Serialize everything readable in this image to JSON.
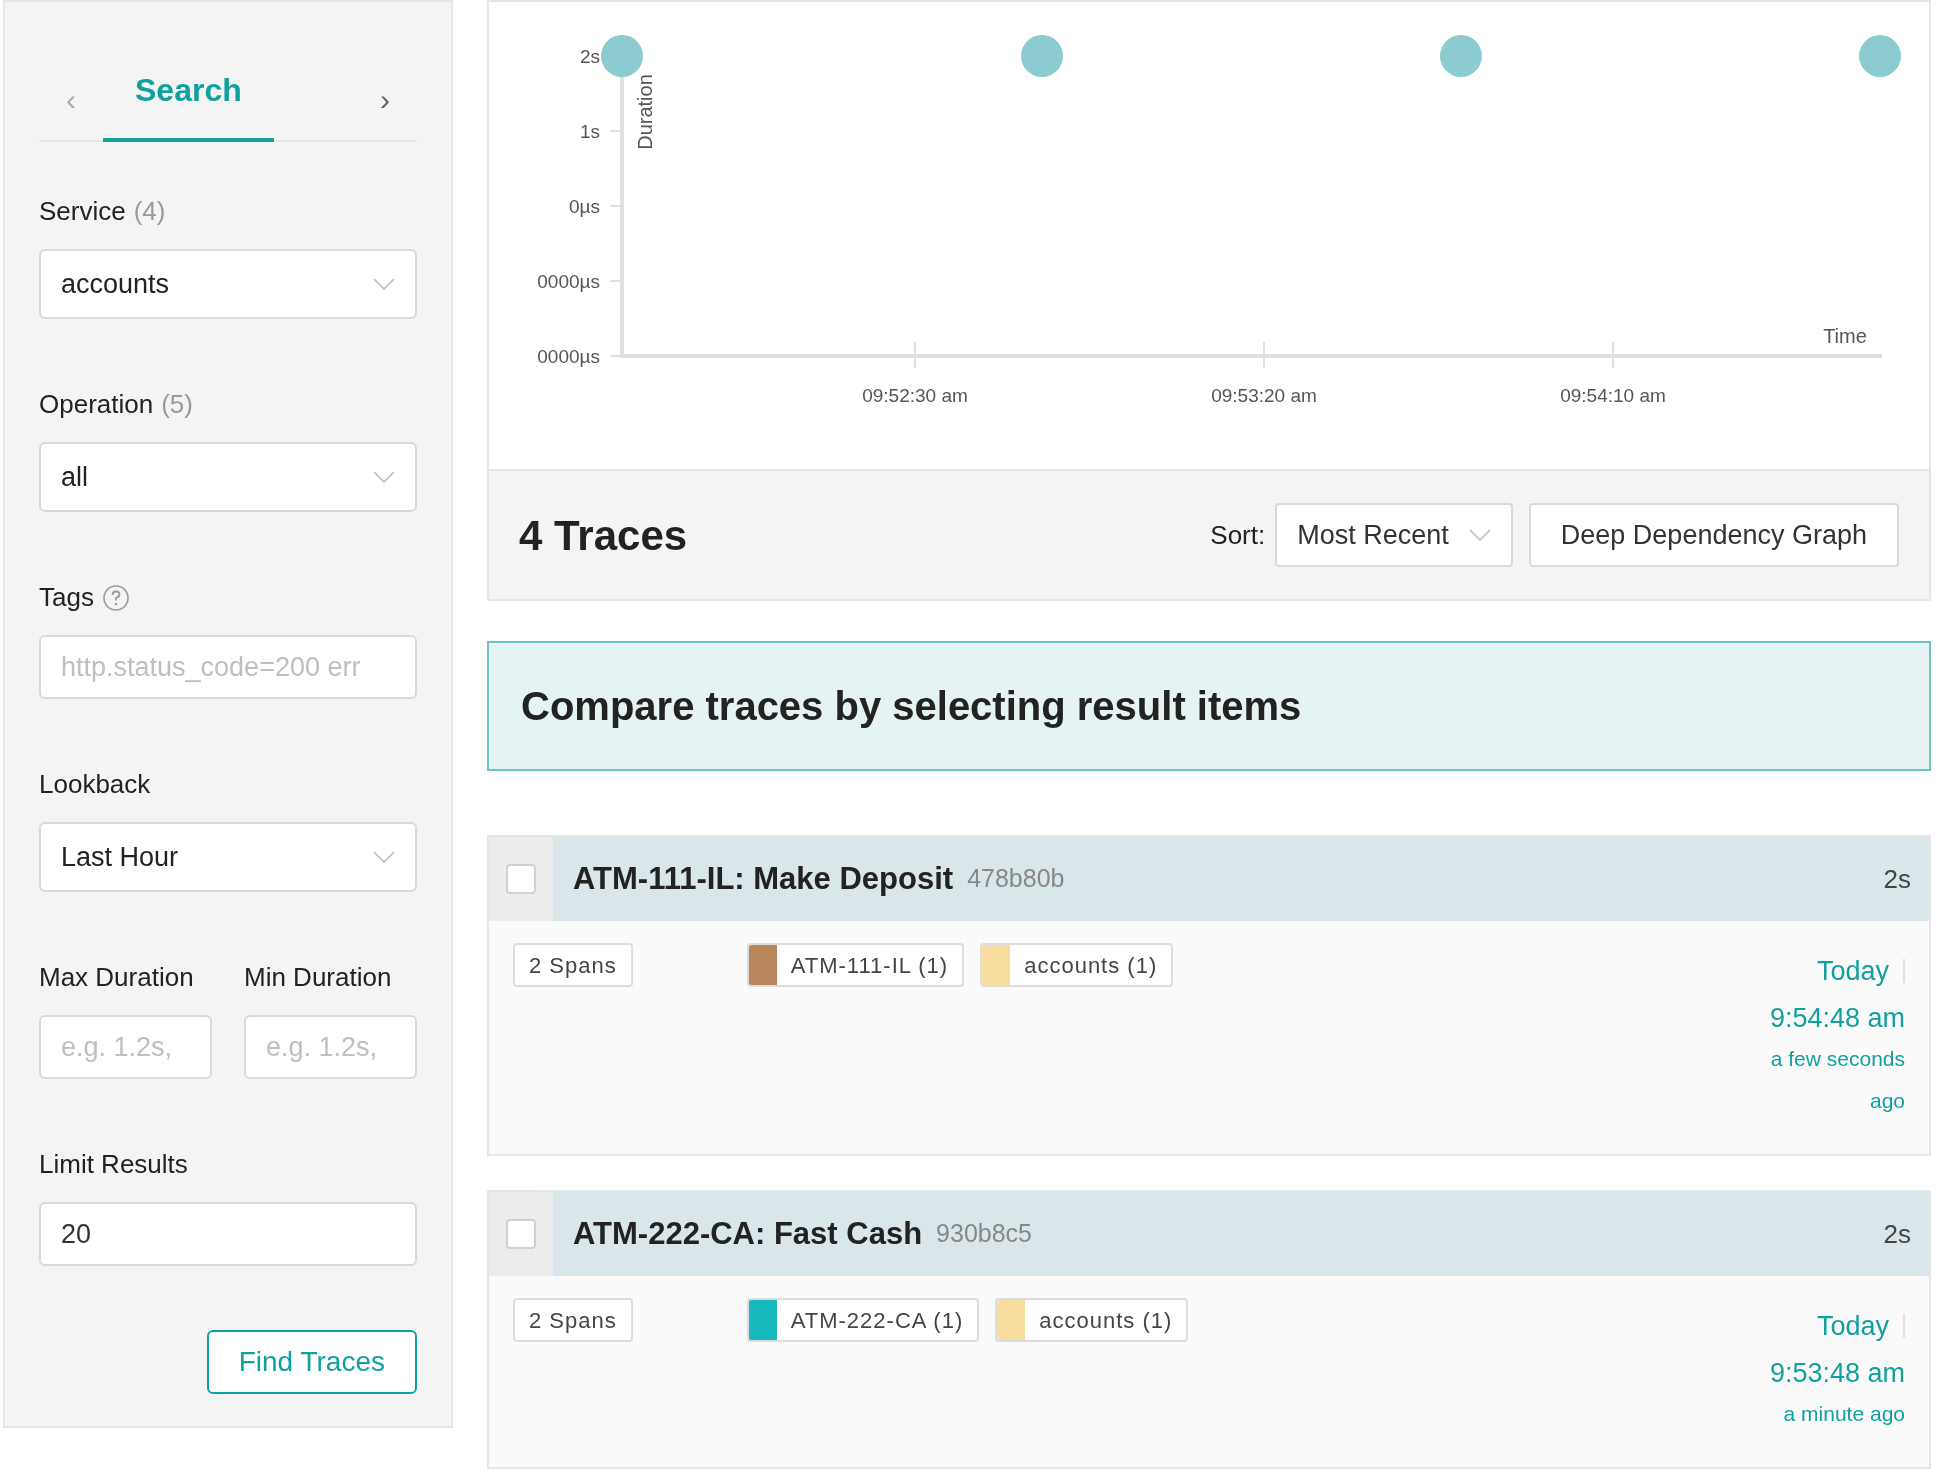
{
  "sidebar": {
    "tabs": [
      {
        "label": "Search",
        "selected": true
      }
    ],
    "prev": "‹",
    "next": "›",
    "rows": [
      {
        "fields": [
          {
            "kind": "select",
            "label": "Service",
            "count": "(4)",
            "value": "accounts"
          }
        ]
      },
      {
        "fields": [
          {
            "kind": "select",
            "label": "Operation",
            "count": "(5)",
            "value": "all"
          }
        ]
      },
      {
        "fields": [
          {
            "kind": "text",
            "label": "Tags",
            "help": true,
            "placeholder": "http.status_code=200 err"
          }
        ]
      },
      {
        "fields": [
          {
            "kind": "select",
            "label": "Lookback",
            "value": "Last Hour"
          }
        ]
      },
      {
        "fields": [
          {
            "kind": "text",
            "label": "Max Duration",
            "placeholder": "e.g. 1.2s,"
          },
          {
            "kind": "text",
            "label": "Min Duration",
            "placeholder": "e.g. 1.2s,"
          }
        ]
      },
      {
        "fields": [
          {
            "kind": "text",
            "label": "Limit Results",
            "value": "20"
          }
        ]
      }
    ],
    "submit": "Find Traces"
  },
  "chart": {
    "xlabel": "Time",
    "ylabel": "Duration",
    "xticks": [
      "09:52:30 am",
      "09:53:20 am",
      "09:54:10 am"
    ],
    "yticks": [
      "2s",
      "1s",
      "0µs",
      "0000µs",
      "0000µs"
    ]
  },
  "results_header": {
    "count": "4 Traces",
    "sort_label": "Sort:",
    "sort_value": "Most Recent",
    "graph_button": "Deep Dependency Graph"
  },
  "compare_banner": "Compare traces by selecting result items",
  "traces": [
    {
      "checked": false,
      "title": "ATM-111-IL: Make Deposit",
      "id": "478b80b",
      "duration": "2s",
      "spans": "2 Spans",
      "services": [
        {
          "name": "ATM-111-IL (1)",
          "color": "#b8865a"
        },
        {
          "name": "accounts (1)",
          "color": "#f8dca0"
        }
      ],
      "day": "Today",
      "time": "9:54:48 am",
      "ago": "a few seconds ago"
    },
    {
      "checked": false,
      "title": "ATM-222-CA: Fast Cash",
      "id": "930b8c5",
      "duration": "2s",
      "spans": "2 Spans",
      "services": [
        {
          "name": "ATM-222-CA (1)",
          "color": "#17b8be"
        },
        {
          "name": "accounts (1)",
          "color": "#f8dca0"
        }
      ],
      "day": "Today",
      "time": "9:53:48 am",
      "ago": "a minute ago"
    }
  ]
}
